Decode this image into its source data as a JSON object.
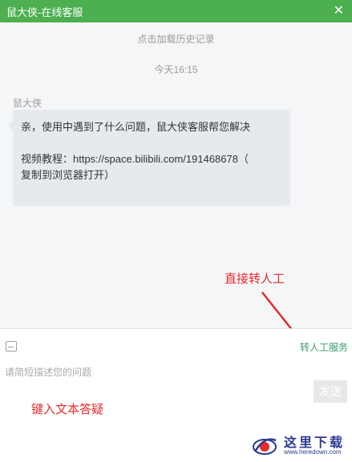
{
  "window": {
    "title": "鼠大侠-在线客服",
    "close_icon": "close-icon",
    "accent_color": "#4caf50"
  },
  "chat": {
    "history_link": "点击加载历史记录",
    "timestamp": "今天16:15",
    "messages": [
      {
        "sender": "鼠大侠",
        "line1": "亲，使用中遇到了什么问题，鼠大侠客服帮您解决",
        "line2": "视频教程：https://space.bilibili.com/191468678（",
        "line3": "复制到浏览器打开）"
      }
    ]
  },
  "toolbar": {
    "emoji_icon": "emoji-icon",
    "transfer_label": "转人工服务"
  },
  "input": {
    "placeholder": "请简短描述您的问题",
    "value": "",
    "send_label": "发送"
  },
  "annotations": {
    "direct_transfer": "直接转人工",
    "type_text": "键入文本答疑",
    "color": "#e52b2b"
  },
  "watermark": {
    "text": "这里下载",
    "url": "www.heredown.com"
  }
}
